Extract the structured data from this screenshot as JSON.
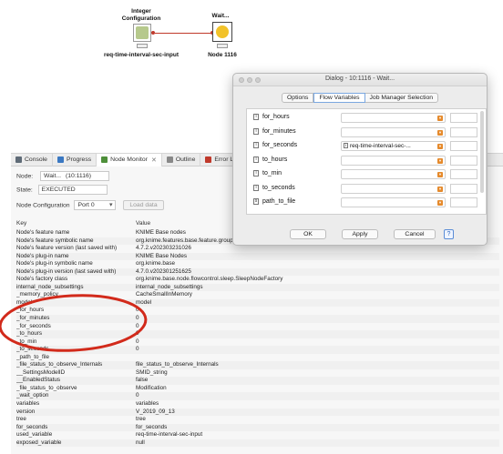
{
  "workflow": {
    "node1": {
      "title_line1": "Integer",
      "title_line2": "Configuration",
      "label": "req-time-interval-sec-input"
    },
    "node2": {
      "title": "Wait...",
      "label": "Node 1116"
    }
  },
  "panel": {
    "tabs": [
      {
        "label": "Console",
        "icon": "console-icon",
        "color": "#5f6b77"
      },
      {
        "label": "Progress",
        "icon": "progress-icon",
        "color": "#3a78c2"
      },
      {
        "label": "Node Monitor",
        "icon": "node-monitor-icon",
        "color": "#4e8f3a"
      },
      {
        "label": "Outline",
        "icon": "outline-icon",
        "color": "#888888"
      },
      {
        "label": "Error Log",
        "icon": "error-log-icon",
        "color": "#c0392b"
      }
    ],
    "node_label": "Node:",
    "node_value": "Wait...",
    "node_id": "(10:1116)",
    "state_label": "State:",
    "state_value": "EXECUTED",
    "config_label": "Node Configuration",
    "port_value": "Port 0",
    "load_button": "Load data",
    "columns": {
      "key": "Key",
      "value": "Value"
    },
    "rows": [
      {
        "key": "Node's feature name",
        "value": "KNIME Base nodes"
      },
      {
        "key": "Node's feature symbolic name",
        "value": "org.knime.features.base.feature.group"
      },
      {
        "key": "Node's feature version (last saved with)",
        "value": "4.7.2.v202303231026"
      },
      {
        "key": "Node's plug-in name",
        "value": "KNIME Base Nodes"
      },
      {
        "key": "Node's plug-in symbolic name",
        "value": "org.knime.base"
      },
      {
        "key": "Node's plug-in version (last saved with)",
        "value": "4.7.0.v202301251625"
      },
      {
        "key": "Node's factory class",
        "value": "org.knime.base.node.flowcontrol.sleep.SleepNodeFactory"
      },
      {
        "key": "internal_node_subsettings",
        "value": "internal_node_subsettings"
      },
      {
        "key": "_memory_policy",
        "value": "CacheSmallInMemory"
      },
      {
        "key": "model",
        "value": "model"
      },
      {
        "key": "_for_hours",
        "value": "0"
      },
      {
        "key": "_for_minutes",
        "value": "0"
      },
      {
        "key": "_for_seconds",
        "value": "0"
      },
      {
        "key": "_to_hours",
        "value": "0"
      },
      {
        "key": "_to_min",
        "value": "0"
      },
      {
        "key": "_to_seconds",
        "value": "0"
      },
      {
        "key": "_path_to_file",
        "value": ""
      },
      {
        "key": "_file_status_to_observe_Internals",
        "value": "file_status_to_observe_Internals"
      },
      {
        "key": "__SettingsModelID",
        "value": "SMID_string"
      },
      {
        "key": "__EnabledStatus",
        "value": "false"
      },
      {
        "key": "_file_status_to_observe",
        "value": "Modification"
      },
      {
        "key": "_wait_option",
        "value": "0"
      },
      {
        "key": "variables",
        "value": "variables"
      },
      {
        "key": "version",
        "value": "V_2019_09_13"
      },
      {
        "key": "tree",
        "value": "tree"
      },
      {
        "key": "for_seconds",
        "value": "for_seconds"
      },
      {
        "key": "used_variable",
        "value": "req-time-interval-sec-input"
      },
      {
        "key": "exposed_variable",
        "value": "null"
      }
    ]
  },
  "dialog": {
    "title": "Dialog - 10:1116 - Wait...",
    "tabs": [
      "Options",
      "Flow Variables",
      "Job Manager Selection"
    ],
    "active_tab": "Flow Variables",
    "variables": [
      {
        "name": "for_hours",
        "badge": "i",
        "selected": ""
      },
      {
        "name": "for_minutes",
        "badge": "i",
        "selected": ""
      },
      {
        "name": "for_seconds",
        "badge": "i",
        "selected": "req-time-interval-sec-..."
      },
      {
        "name": "to_hours",
        "badge": "i",
        "selected": ""
      },
      {
        "name": "to_min",
        "badge": "i",
        "selected": ""
      },
      {
        "name": "to_seconds",
        "badge": "i",
        "selected": ""
      },
      {
        "name": "path_to_file",
        "badge": "s",
        "selected": ""
      }
    ],
    "ok_label": "OK",
    "apply_label": "Apply",
    "cancel_label": "Cancel",
    "help_label": "?"
  },
  "annotations": {
    "ellipse_color": "#1e3cc9",
    "ellipse2_color": "#d22a1b"
  }
}
